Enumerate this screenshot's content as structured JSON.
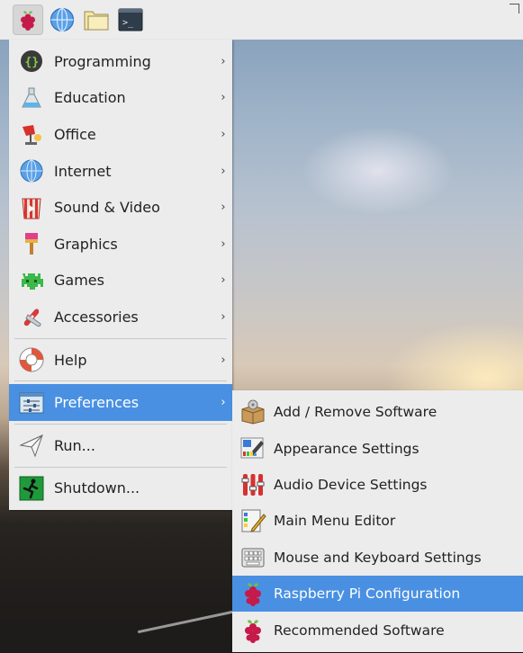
{
  "taskbar": {
    "buttons": [
      {
        "name": "raspberry-icon"
      },
      {
        "name": "web-browser-icon"
      },
      {
        "name": "file-manager-icon"
      },
      {
        "name": "terminal-icon",
        "glyph": ">_"
      }
    ]
  },
  "menu": {
    "items": [
      {
        "label": "Programming",
        "icon": "programming-icon",
        "has_submenu": true
      },
      {
        "label": "Education",
        "icon": "education-icon",
        "has_submenu": true
      },
      {
        "label": "Office",
        "icon": "office-icon",
        "has_submenu": true
      },
      {
        "label": "Internet",
        "icon": "internet-icon",
        "has_submenu": true
      },
      {
        "label": "Sound & Video",
        "icon": "sound-video-icon",
        "has_submenu": true
      },
      {
        "label": "Graphics",
        "icon": "graphics-icon",
        "has_submenu": true
      },
      {
        "label": "Games",
        "icon": "games-icon",
        "has_submenu": true
      },
      {
        "label": "Accessories",
        "icon": "accessories-icon",
        "has_submenu": true
      },
      {
        "label": "Help",
        "icon": "help-icon",
        "has_submenu": true
      },
      {
        "label": "Preferences",
        "icon": "preferences-icon",
        "has_submenu": true,
        "selected": true
      },
      {
        "label": "Run...",
        "icon": "run-icon",
        "has_submenu": false
      },
      {
        "label": "Shutdown...",
        "icon": "shutdown-icon",
        "has_submenu": false
      }
    ],
    "arrow": "›"
  },
  "submenu": {
    "items": [
      {
        "label": "Add / Remove Software",
        "icon": "add-remove-software-icon"
      },
      {
        "label": "Appearance Settings",
        "icon": "appearance-settings-icon"
      },
      {
        "label": "Audio Device Settings",
        "icon": "audio-device-settings-icon"
      },
      {
        "label": "Main Menu Editor",
        "icon": "main-menu-editor-icon"
      },
      {
        "label": "Mouse and Keyboard Settings",
        "icon": "mouse-keyboard-settings-icon"
      },
      {
        "label": "Raspberry Pi Configuration",
        "icon": "raspberry-pi-configuration-icon",
        "selected": true
      },
      {
        "label": "Recommended Software",
        "icon": "recommended-software-icon"
      }
    ]
  },
  "colors": {
    "selection": "#4a90e2",
    "menu_bg": "#ececec",
    "raspberry_red": "#c51a4a",
    "raspberry_green": "#6cc04a"
  }
}
